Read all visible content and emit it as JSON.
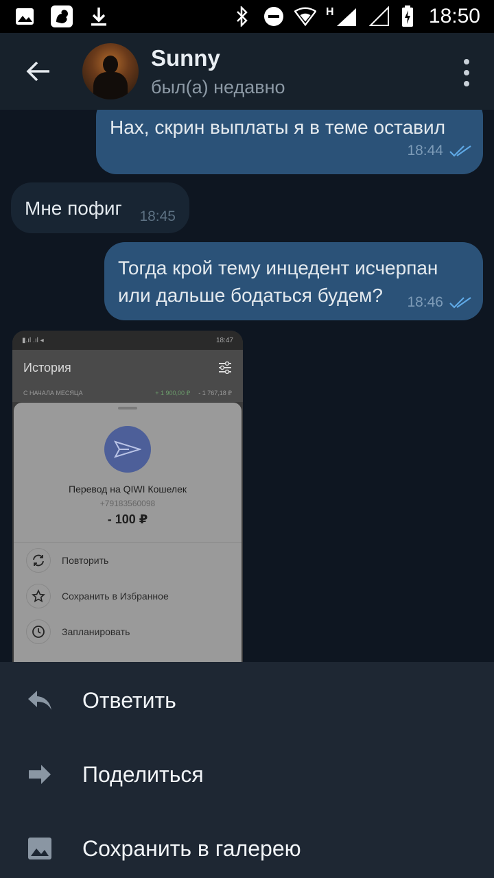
{
  "status_bar": {
    "time": "18:50",
    "network_letter": "H"
  },
  "header": {
    "peer_name": "Sunny",
    "peer_status": "был(а) недавно"
  },
  "messages": [
    {
      "direction": "out",
      "text": "Нах, скрин выплаты я в теме оставил",
      "time": "18:44",
      "read": true
    },
    {
      "direction": "in",
      "text": "Мне пофиг",
      "time": "18:45"
    },
    {
      "direction": "out",
      "text_line1": "Тогда крой тему инцедент исчерпан",
      "text_line2": "или дальше бодаться будем?",
      "time": "18:46",
      "read": true
    }
  ],
  "photo": {
    "status_time": "18:47",
    "title": "История",
    "row_label": "С НАЧАЛА МЕСЯЦА",
    "row_pos": "+ 1 900,00 ₽",
    "row_neg": "- 1 767,18 ₽",
    "transfer_title": "Перевод на QIWI Кошелек",
    "transfer_phone": "+79183560098",
    "transfer_amount": "- 100 ₽",
    "actions": [
      "Повторить",
      "Сохранить в Избранное",
      "Запланировать"
    ]
  },
  "menu": {
    "reply": "Ответить",
    "share": "Поделиться",
    "save_gallery": "Сохранить в галерею"
  },
  "colors": {
    "background": "#0e1621",
    "header": "#17212b",
    "outgoing_bubble": "#2b5278",
    "incoming_bubble": "#182533",
    "menu_bg": "#1e2733",
    "read_check": "#5fa9e6"
  }
}
